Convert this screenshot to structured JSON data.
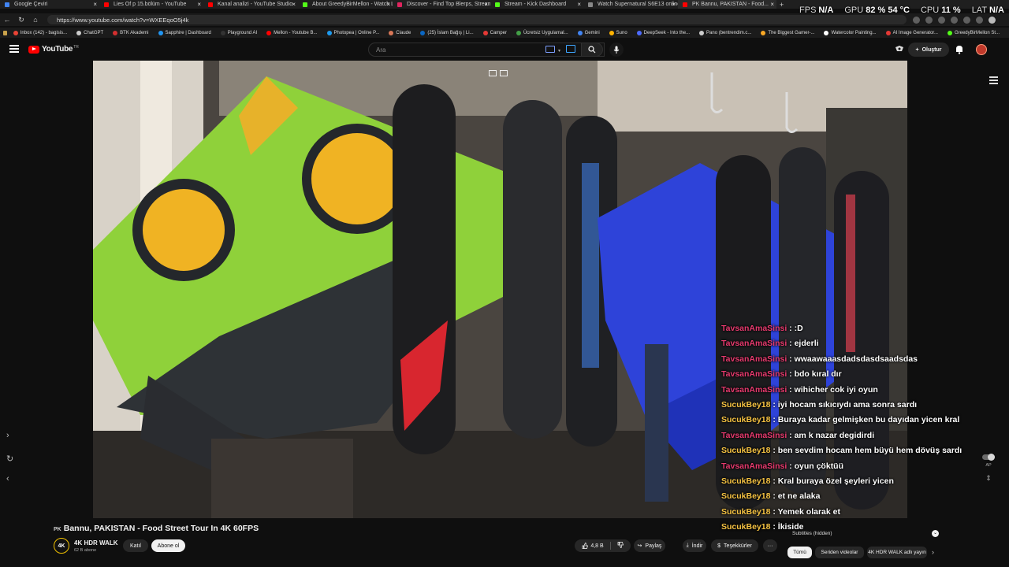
{
  "browser": {
    "tabs": [
      {
        "label": "Google Çeviri",
        "color": "#4285f4",
        "active": false
      },
      {
        "label": "Lies Of p 15.bölüm - YouTube",
        "color": "#ff0000",
        "active": false
      },
      {
        "label": "Kanal analizi - YouTube Studio",
        "color": "#ff0000",
        "active": false
      },
      {
        "label": "About GreedyBirMellon - Watch Li...",
        "color": "#53fc18",
        "active": false
      },
      {
        "label": "Discover - Find Top Blerps, Stream...",
        "color": "#e0245e",
        "active": false
      },
      {
        "label": "Stream - Kick Dashboard",
        "color": "#53fc18",
        "active": false
      },
      {
        "label": "Watch Supernatural S6E13 online...",
        "color": "#888888",
        "active": false
      },
      {
        "label": "PK Bannu, PAKISTAN - Food...",
        "color": "#ff0000",
        "active": true
      }
    ],
    "newtab": "+",
    "url": "https://www.youtube.com/watch?v=WXEEqoO5j4k",
    "bookmarks": [
      {
        "label": "Inbox (142) - bagisis...",
        "color": "#ea4335"
      },
      {
        "label": "ChatGPT",
        "color": "#cccccc"
      },
      {
        "label": "BTK Akademi",
        "color": "#d32f2f"
      },
      {
        "label": "Sapphire | Dashboard",
        "color": "#2196f3"
      },
      {
        "label": "Playground AI",
        "color": "#333333"
      },
      {
        "label": "Mellon - Youtube B...",
        "color": "#ff0000"
      },
      {
        "label": "Photopea | Online P...",
        "color": "#1d9bf0"
      },
      {
        "label": "Claude",
        "color": "#d97757"
      },
      {
        "label": "(25) İslam Bağış | Li...",
        "color": "#0a66c2"
      },
      {
        "label": "Camper",
        "color": "#e53935"
      },
      {
        "label": "Ücretsiz Uygulamal...",
        "color": "#43a047"
      },
      {
        "label": "Gemini",
        "color": "#4285f4"
      },
      {
        "label": "Suno",
        "color": "#ffb300"
      },
      {
        "label": "DeepSeek - Into the...",
        "color": "#4d6bfe"
      },
      {
        "label": "Pano (bentrendim.c...",
        "color": "#cccccc"
      },
      {
        "label": "The Biggest Gamer-...",
        "color": "#f9a825"
      },
      {
        "label": "Watercolor Painting...",
        "color": "#ffffff"
      },
      {
        "label": "AI Image Generator...",
        "color": "#e53935"
      },
      {
        "label": "GreedyBirMellon St...",
        "color": "#53fc18"
      }
    ]
  },
  "hud": {
    "fps_label": "FPS",
    "fps_value": "N/A",
    "gpu_label": "GPU",
    "gpu_value": "82 % 54 °C",
    "cpu_label": "CPU",
    "cpu_value": "11 %",
    "lat_label": "LAT",
    "lat_value": "N/A"
  },
  "youtube": {
    "logo": "YouTube",
    "region": "TR",
    "search_placeholder": "Ara",
    "create_label": "Oluştur"
  },
  "chat": [
    {
      "user": "TavsanAmaSinsi",
      "msg": " : :D",
      "color": "#e73a6e"
    },
    {
      "user": "TavsanAmaSinsi",
      "msg": " : ejderli",
      "color": "#e73a6e"
    },
    {
      "user": "TavsanAmaSinsi",
      "msg": " : wwaawaaasdadsdasdsaadsdas",
      "color": "#e73a6e"
    },
    {
      "user": "TavsanAmaSinsi",
      "msg": " : bdo kıral dır",
      "color": "#e73a6e"
    },
    {
      "user": "TavsanAmaSinsi",
      "msg": " : wihicher cok iyi oyun",
      "color": "#e73a6e"
    },
    {
      "user": "SucukBey18",
      "msg": " : iyi hocam sıkıcıydı ama sonra sardı",
      "color": "#f5c242"
    },
    {
      "user": "SucukBey18",
      "msg": " : Buraya kadar gelmişken bu dayıdan yicen kral",
      "color": "#f5c242"
    },
    {
      "user": "TavsanAmaSinsi",
      "msg": " : am k nazar degidirdi",
      "color": "#e73a6e"
    },
    {
      "user": "SucukBey18",
      "msg": " : ben sevdim hocam hem büyü hem dövüş sardı",
      "color": "#f5c242"
    },
    {
      "user": "TavsanAmaSinsi",
      "msg": " : oyun çöktüü",
      "color": "#e73a6e"
    },
    {
      "user": "SucukBey18",
      "msg": " : Kral buraya özel şeyleri yicen",
      "color": "#f5c242"
    },
    {
      "user": "SucukBey18",
      "msg": " : et ne alaka",
      "color": "#f5c242"
    },
    {
      "user": "SucukBey18",
      "msg": " : Yemek olarak et",
      "color": "#f5c242"
    },
    {
      "user": "SucukBey18",
      "msg": " : İkiside",
      "color": "#f5c242"
    }
  ],
  "side": {
    "autoplay_label": "AP"
  },
  "video": {
    "flag": "PK",
    "title": "Bannu, PAKISTAN - Food Street Tour In 4K 60FPS",
    "channel_logo": "4K",
    "channel": "4K HDR WALK",
    "subscribers": "62 B abone",
    "join": "Katıl",
    "subscribe": "Abone ol",
    "likes": "4,8 B",
    "share": "Paylaş",
    "download": "İndir",
    "thanks": "Teşekkürler",
    "more": "···"
  },
  "panel": {
    "subtitles": "Subtitles (hidden)",
    "chips": [
      "Tümü",
      "Seriden videolar",
      "4K HDR WALK adlı yayın"
    ],
    "next": "›"
  }
}
